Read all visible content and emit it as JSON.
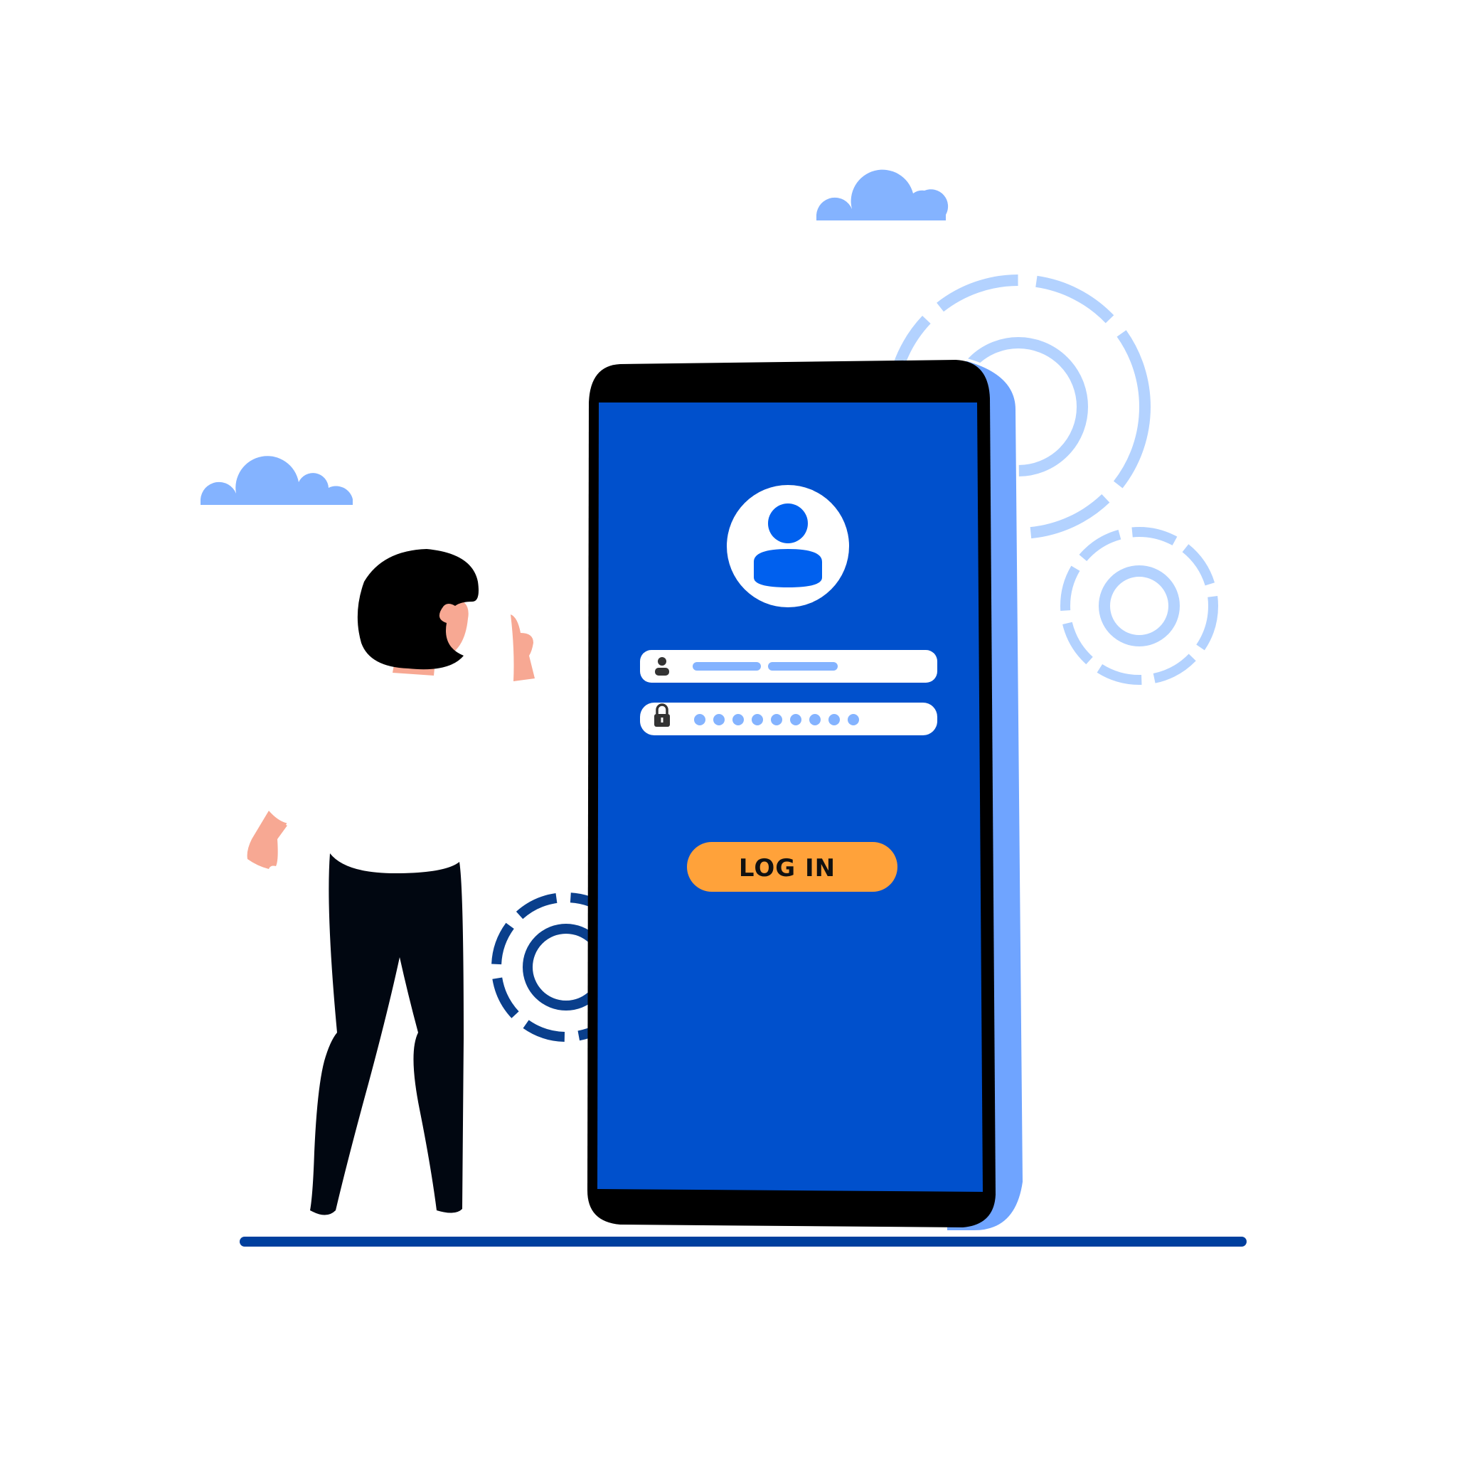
{
  "login_form": {
    "login_button_label": "LOG IN",
    "password_mask_count": 9
  },
  "colors": {
    "screen": "#0050cc",
    "phone_frame": "#000000",
    "phone_side": "#6fa4ff",
    "gear_light": "#b3d2ff",
    "gear_dark": "#0a3f8c",
    "cloud": "#84b3ff",
    "login_button": "#ffa23a",
    "avatar_blue": "#0060ee",
    "field_dash": "#84b3ff",
    "ground_line": "#003f9e",
    "skin": "#f7a893",
    "hair": "#000000",
    "pants": "#010711"
  },
  "icons": {
    "username": "user-icon",
    "password": "lock-icon",
    "avatar": "profile-avatar-icon"
  }
}
